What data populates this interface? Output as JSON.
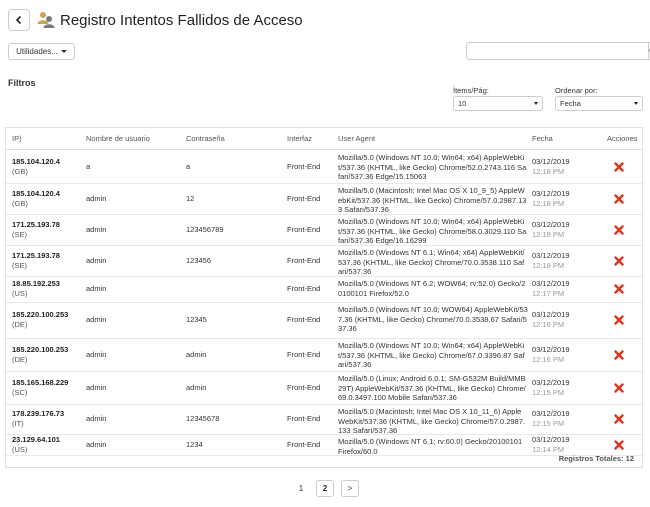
{
  "header": {
    "title": "Registro Intentos Fallidos de Acceso"
  },
  "toolbar": {
    "utilities_label": "Utilidades...",
    "search_placeholder": ""
  },
  "filters": {
    "title": "Filtros",
    "items_label": "Ítems/Pág:",
    "items_value": "10",
    "order_label": "Ordenar por:",
    "order_value": "Fecha"
  },
  "table": {
    "columns": [
      "IP)",
      "Nombre de usuario",
      "Contraseña",
      "Interfaz",
      "User Agent",
      "Fecha",
      "Acciones"
    ],
    "rows": [
      {
        "ip": "185.104.120.4",
        "country": "(GB)",
        "user": "a",
        "pass": "a",
        "iface": "Front-End",
        "ua": "Mozilla/5.0 (Windows NT 10.0; Win64; x64) AppleWebKit/537.36 (KHTML, like Gecko) Chrome/52.0.2743.116 Safari/537.36 Edge/15.15063",
        "date": "03/12/2019",
        "time": "12:18 PM"
      },
      {
        "ip": "185.104.120.4",
        "country": "(GB)",
        "user": "admin",
        "pass": "12",
        "iface": "Front-End",
        "ua": "Mozilla/5.0 (Macintosh; Intel Mac OS X 10_9_5) AppleWebKit/537.36 (KHTML, like Gecko) Chrome/57.0.2987.133 Safari/537.36",
        "date": "03/12/2019",
        "time": "12:18 PM"
      },
      {
        "ip": "171.25.193.78",
        "country": "(SE)",
        "user": "admin",
        "pass": "123456789",
        "iface": "Front-End",
        "ua": "Mozilla/5.0 (Windows NT 10.0; Win64; x64) AppleWebKit/537.36 (KHTML, like Gecko) Chrome/58.0.3029.110 Safari/537.36 Edge/16.16299",
        "date": "03/12/2019",
        "time": "12:18 PM"
      },
      {
        "ip": "171.25.193.78",
        "country": "(SE)",
        "user": "admin",
        "pass": "123456",
        "iface": "Front-End",
        "ua": "Mozilla/5.0 (Windows NT 6.1; Win64; x64) AppleWebKit/537.36 (KHTML, like Gecko) Chrome/70.0.3538.110 Safari/537.36",
        "date": "03/12/2019",
        "time": "12:18 PM"
      },
      {
        "ip": "18.85.192.253",
        "country": "(US)",
        "user": "admin",
        "pass": "",
        "iface": "Front-End",
        "ua": "Mozilla/5.0 (Windows NT 6.2; WOW64; rv:52.0) Gecko/20100101 Firefox/52.0",
        "date": "03/12/2019",
        "time": "12:17 PM"
      },
      {
        "ip": "185.220.100.253",
        "country": "(DE)",
        "user": "admin",
        "pass": "12345",
        "iface": "Front-End",
        "ua": "Mozilla/5.0 (Windows NT 10.0; WOW64) AppleWebKit/537.36 (KHTML, like Gecko) Chrome/70.0.3538.67 Safari/537.36",
        "date": "03/12/2019",
        "time": "12:16 PM"
      },
      {
        "ip": "185.220.100.253",
        "country": "(DE)",
        "user": "admin",
        "pass": "admin",
        "iface": "Front-End",
        "ua": "Mozilla/5.0 (Windows NT 10.0; Win64; x64) AppleWebKit/537.36 (KHTML, like Gecko) Chrome/67.0.3396.87 Safari/537.36",
        "date": "03/12/2019",
        "time": "12:16 PM"
      },
      {
        "ip": "185.165.168.229",
        "country": "(SC)",
        "user": "admin",
        "pass": "admin",
        "iface": "Front-End",
        "ua": "Mozilla/5.0 (Linux; Android 6.0.1; SM-G532M Build/MMB29T) AppleWebKit/537.36 (KHTML, like Gecko) Chrome/69.0.3497.100 Mobile Safari/537.36",
        "date": "03/12/2019",
        "time": "12:15 PM"
      },
      {
        "ip": "178.239.176.73",
        "country": "(IT)",
        "user": "admin",
        "pass": "12345678",
        "iface": "Front-End",
        "ua": "Mozilla/5.0 (Macintosh; Intel Mac OS X 10_11_6) AppleWebKit/537.36 (KHTML, like Gecko) Chrome/57.0.2987.133 Safari/537.36",
        "date": "03/12/2019",
        "time": "12:15 PM"
      },
      {
        "ip": "23.129.64.101",
        "country": "(US)",
        "user": "admin",
        "pass": "1234",
        "iface": "Front-End",
        "ua": "Mozilla/5.0 (Windows NT 6.1; rv:60.0) Gecko/20100101 Firefox/60.0",
        "date": "03/12/2019",
        "time": "12:14 PM"
      }
    ],
    "total_label": "Registros Totales: 12"
  },
  "pagination": {
    "pages": [
      "1",
      "2"
    ],
    "current": "2",
    "next": ">"
  },
  "colors": {
    "delete": "#e0341d",
    "accent": "#333333"
  },
  "icons": {
    "back": "chevron-left-icon",
    "title": "users-icon",
    "search": "search-icon",
    "delete": "delete-icon"
  }
}
